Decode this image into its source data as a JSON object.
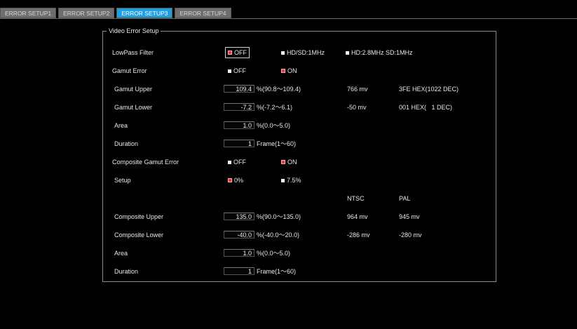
{
  "tabs": [
    {
      "label": "ERROR SETUP1",
      "active": false
    },
    {
      "label": "ERROR SETUP2",
      "active": false
    },
    {
      "label": "ERROR SETUP3",
      "active": true
    },
    {
      "label": "ERROR SETUP4",
      "active": false
    }
  ],
  "panel": {
    "title": "Video Error Setup",
    "lowpass": {
      "label": "LowPass Filter",
      "options": [
        "OFF",
        "HD/SD:1MHz",
        "HD:2.8MHz SD:1MHz"
      ],
      "selected": "OFF"
    },
    "gamut_error": {
      "label": "Gamut Error",
      "options": [
        "OFF",
        "ON"
      ],
      "selected": "ON"
    },
    "gamut_upper": {
      "label": "Gamut Upper",
      "value": "109.4",
      "range": "%(90.8～109.4)",
      "mv": "766 mv",
      "hex": "3FE HEX(1022 DEC)"
    },
    "gamut_lower": {
      "label": "Gamut Lower",
      "value": "-7.2",
      "range": "%(-7.2～6.1)",
      "mv": "-50 mv",
      "hex": "001 HEX(   1 DEC)"
    },
    "area1": {
      "label": "Area",
      "value": "1.0",
      "range": "%(0.0～5.0)"
    },
    "duration1": {
      "label": "Duration",
      "value": "1",
      "range": "Frame(1～60)"
    },
    "composite_gamut_error": {
      "label": "Composite Gamut Error",
      "options": [
        "OFF",
        "ON"
      ],
      "selected": "ON"
    },
    "setup": {
      "label": "Setup",
      "options": [
        "0%",
        "7.5%"
      ],
      "selected": "0%"
    },
    "columns": {
      "ntsc": "NTSC",
      "pal": "PAL"
    },
    "composite_upper": {
      "label": "Composite Upper",
      "value": "135.0",
      "range": "%(90.0～135.0)",
      "ntsc": "964 mv",
      "pal": "945 mv"
    },
    "composite_lower": {
      "label": "Composite Lower",
      "value": "-40.0",
      "range": "%(-40.0～20.0)",
      "ntsc": "-286 mv",
      "pal": "-280 mv"
    },
    "area2": {
      "label": "Area",
      "value": "1.0",
      "range": "%(0.0～5.0)"
    },
    "duration2": {
      "label": "Duration",
      "value": "1",
      "range": "Frame(1～60)"
    }
  },
  "colors": {
    "active_tab": "#1ea0e0",
    "selected_radio": "#e83a3a",
    "background": "#000000"
  }
}
